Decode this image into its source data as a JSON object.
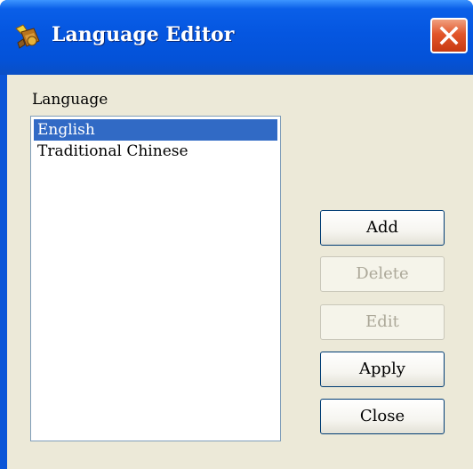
{
  "window": {
    "title": "Language Editor",
    "title_icon": "language-editor-icon",
    "close_icon": "close-icon"
  },
  "language_section": {
    "label": "Language",
    "items": [
      {
        "label": "English",
        "selected": true
      },
      {
        "label": "Traditional Chinese",
        "selected": false
      }
    ]
  },
  "buttons": {
    "add": {
      "label": "Add",
      "enabled": true
    },
    "delete": {
      "label": "Delete",
      "enabled": false
    },
    "edit": {
      "label": "Edit",
      "enabled": false
    },
    "apply": {
      "label": "Apply",
      "enabled": true
    },
    "close": {
      "label": "Close",
      "enabled": true
    }
  },
  "colors": {
    "titlebar": "#0556e0",
    "selection": "#316ac5",
    "client_bg": "#ece9d8",
    "close_button": "#e2562a"
  }
}
